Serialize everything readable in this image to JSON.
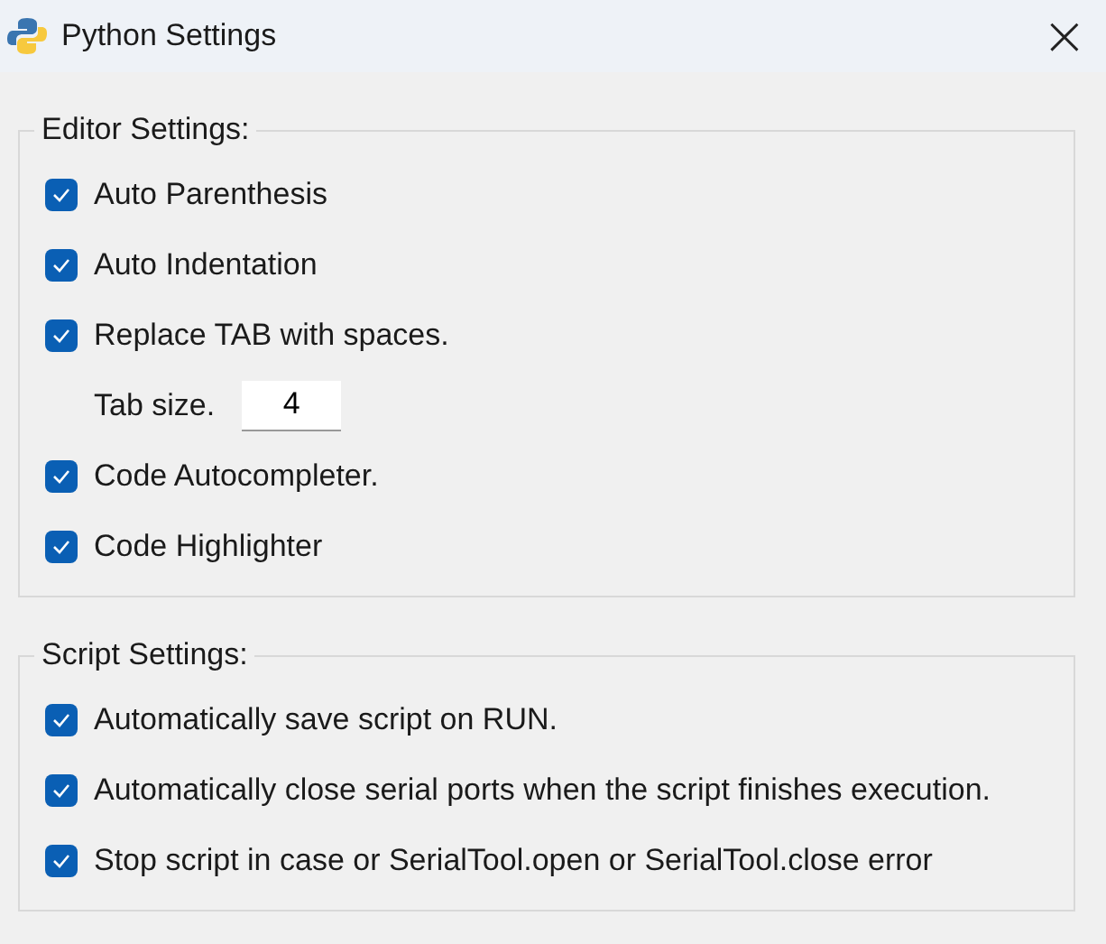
{
  "window": {
    "title": "Python Settings",
    "close": "×"
  },
  "groups": [
    {
      "title": "Editor Settings:",
      "items": [
        {
          "kind": "checkbox",
          "label": "Auto Parenthesis",
          "checked": true
        },
        {
          "kind": "checkbox",
          "label": "Auto Indentation",
          "checked": true
        },
        {
          "kind": "checkbox",
          "label": "Replace TAB with spaces.",
          "checked": true
        },
        {
          "kind": "number",
          "label": "Tab size.",
          "value": "4"
        },
        {
          "kind": "checkbox",
          "label": "Code Autocompleter.",
          "checked": true
        },
        {
          "kind": "checkbox",
          "label": "Code Highlighter",
          "checked": true
        }
      ]
    },
    {
      "title": "Script Settings:",
      "items": [
        {
          "kind": "checkbox",
          "label": "Automatically save script on RUN.",
          "checked": true
        },
        {
          "kind": "checkbox",
          "label": "Automatically close serial ports when the script finishes execution.",
          "checked": true
        },
        {
          "kind": "checkbox",
          "label": "Stop script in case or SerialTool.open or SerialTool.close error",
          "checked": true
        }
      ]
    }
  ]
}
